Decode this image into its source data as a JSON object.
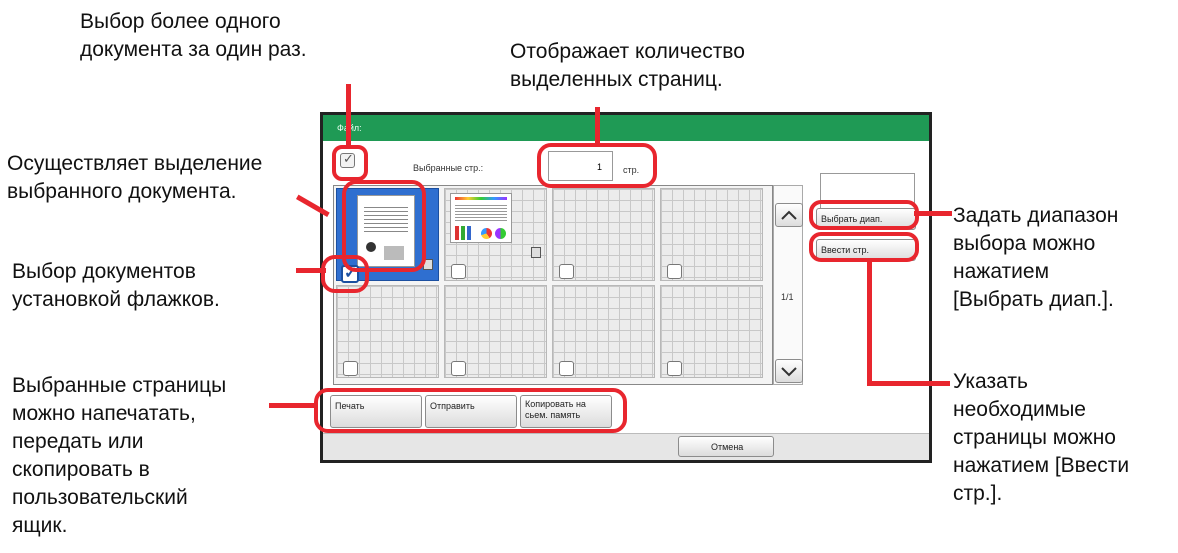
{
  "annotations": {
    "multi_select": "Выбор более одного\nдокумента за один раз.",
    "count": "Отображает количество\nвыделенных страниц.",
    "select_doc": "Осуществляет выделение\nвыбранного документа.",
    "checkbox_select": "Выбор документов\nустановкой флажков.",
    "actions": "Выбранные страницы\nможно напечатать,\nпередать или\nскопировать в\nпользовательский\nящик.",
    "range": "Задать диапазон\nвыбора можно\nнажатием\n[Выбрать диап.].",
    "enter_pages": "Указать\nнеобходимые\nстраницы можно\nнажатием [Ввести\nстр.]."
  },
  "screen": {
    "title": "Файл:",
    "selected_label": "Выбранные стр.:",
    "selected_count": "1",
    "pages_unit": "стр.",
    "page_indicator": "1/1",
    "select_range_button": "Выбрать диап.",
    "enter_pages_button": "Ввести стр.",
    "print_button": "Печать",
    "send_button": "Отправить",
    "copy_button": "Копировать на\nсьем. память",
    "cancel_button": "Отмена"
  },
  "colors": {
    "accent": "#e8262e",
    "titlebar": "#1f9a55",
    "selected_tile": "#2f6fd0"
  }
}
